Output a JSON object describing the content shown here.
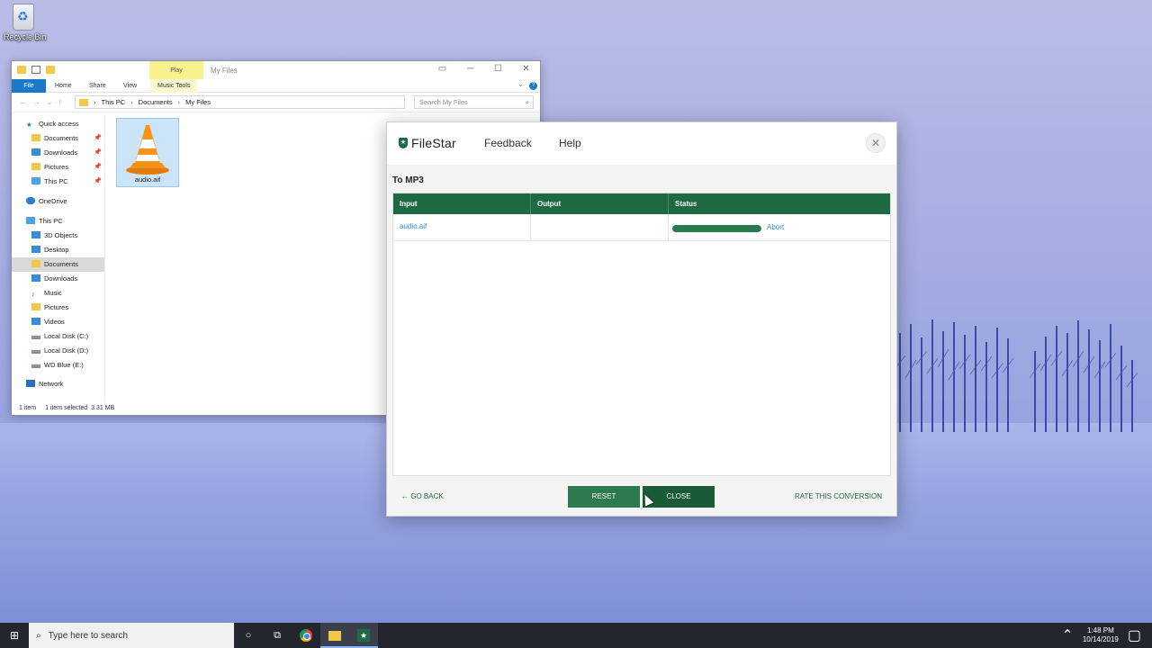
{
  "desktop": {
    "recycle_bin_label": "Recycle Bin"
  },
  "explorer": {
    "contextual_tab": "Play",
    "window_title": "My Files",
    "ribbon_tabs": [
      "File",
      "Home",
      "Share",
      "View",
      "Music Tools"
    ],
    "breadcrumb": [
      "This PC",
      "Documents",
      "My Files"
    ],
    "search_placeholder": "Search My Files",
    "nav_items": [
      {
        "label": "Quick access"
      },
      {
        "label": "Documents"
      },
      {
        "label": "Downloads"
      },
      {
        "label": "Pictures"
      },
      {
        "label": "This PC"
      },
      {
        "label": "OneDrive"
      },
      {
        "label": "This PC"
      },
      {
        "label": "3D Objects"
      },
      {
        "label": "Desktop"
      },
      {
        "label": "Documents"
      },
      {
        "label": "Downloads"
      },
      {
        "label": "Music"
      },
      {
        "label": "Pictures"
      },
      {
        "label": "Videos"
      },
      {
        "label": "Local Disk (C:)"
      },
      {
        "label": "Local Disk (D:)"
      },
      {
        "label": "WD Blue (E:)"
      },
      {
        "label": "Network"
      }
    ],
    "file": {
      "name": "audio.aif"
    },
    "status": {
      "count": "1 item",
      "selected": "1 item selected",
      "size": "3.31 MB"
    }
  },
  "filestar": {
    "logo": "FileStar",
    "menu": {
      "feedback": "Feedback",
      "help": "Help"
    },
    "conversion_title": "To MP3",
    "columns": [
      "Input",
      "Output",
      "Status"
    ],
    "rows": [
      {
        "input": "audio.aif",
        "output": "",
        "progress": 1.0,
        "action": "Abort"
      }
    ],
    "footer": {
      "go_back": "GO BACK",
      "reset": "RESET",
      "close": "CLOSE",
      "rate": "RATE THIS CONVERSION"
    },
    "colors": {
      "brand_green": "#1e6a42",
      "link_blue": "#2f8ed2"
    }
  },
  "taskbar": {
    "search_placeholder": "Type here to search",
    "time": "1:48 PM",
    "date": "10/14/2019"
  }
}
